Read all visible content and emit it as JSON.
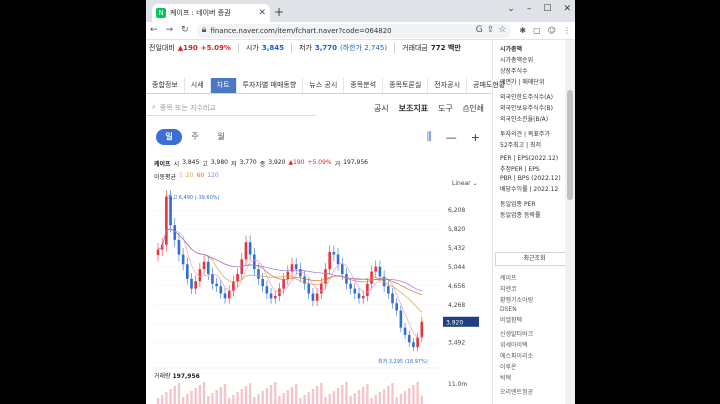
{
  "browser": {
    "tab_title": "케이프 : 네이버 증권",
    "url": "finance.naver.com/item/fchart.naver?code=064820"
  },
  "quote": {
    "prev_label": "전일대비",
    "change": "▲190",
    "pct": "+5.09%",
    "high_label": "시가",
    "open": "3,845",
    "low_label": "저가",
    "low": "3,770",
    "low_limit": "(하한가 2,745)",
    "amount_label": "거래대금",
    "amount": "772 백만"
  },
  "nav": {
    "tabs": [
      "종합정보",
      "시세",
      "차트",
      "투자자별 매매동향",
      "뉴스 공시",
      "종목분석",
      "종목토론실",
      "전자공시",
      "공매도현황"
    ],
    "active": "차트"
  },
  "search": {
    "placeholder": "종목 또는 지수비교"
  },
  "tools": {
    "notice": "공시",
    "indicator": "보조지표",
    "tool": "도구",
    "print": "인쇄"
  },
  "periods": {
    "day": "일",
    "week": "주",
    "month": "월"
  },
  "ohlc": {
    "name": "케이프",
    "open_label": "시",
    "open": "3,845",
    "high_label": "고",
    "high": "3,980",
    "low_label": "저",
    "low": "3,770",
    "close_label": "종",
    "close": "3,920",
    "change": "▲190",
    "pct": "+5.09%",
    "vol_label": "거",
    "vol": "197,956"
  },
  "ma": {
    "label": "이동평균",
    "p5": "5",
    "p20": "20",
    "p60": "60",
    "p120": "120"
  },
  "scale": "Linear",
  "chart_data": {
    "type": "candlestick",
    "y_ticks": [
      "6,208",
      "5,820",
      "5,432",
      "5,044",
      "4,656",
      "4,268",
      "3,880",
      "3,492"
    ],
    "current_price": "3,920",
    "max_annot": "최고 6,490 (-39.60%)",
    "min_annot": "최저 3,295 (18.97%)",
    "closes": [
      5400,
      5500,
      6490,
      5900,
      5600,
      5300,
      5100,
      4800,
      4600,
      4750,
      5000,
      5150,
      4900,
      4700,
      4650,
      4500,
      4400,
      4550,
      4750,
      4900,
      5200,
      5550,
      5300,
      5000,
      4800,
      4650,
      4500,
      4400,
      4450,
      4600,
      4800,
      4950,
      5100,
      5000,
      4850,
      4700,
      4500,
      4350,
      4500,
      4700,
      5000,
      5350,
      5300,
      5100,
      4900,
      4700,
      4600,
      4500,
      4400,
      4450,
      4700,
      4950,
      5050,
      4850,
      4650,
      4500,
      4300,
      4150,
      3800,
      3650,
      3500,
      3400,
      3600,
      3920
    ],
    "volume_label": "거래량",
    "volume": "197,956",
    "vol_axis": "11.0m"
  },
  "right_panel": {
    "items": [
      "시가총액",
      "시가총액순위",
      "상장주식수",
      "액면가 | 매매단위",
      "",
      "외국인한도주식수(A)",
      "외국인보유주식수(B)",
      "외국인소진율(B/A)",
      "",
      "투자의견 | 목표주가",
      "52주최고 | 최저",
      "",
      "PER | EPS(2022.12)",
      "추정PER | EPS",
      "PBR | BPS (2022.12)",
      "배당수익률 | 2022.12",
      "",
      "동일업종 PER",
      "동일업종 등락률"
    ],
    "recent_title": "최근조회",
    "recent": [
      "케이프",
      "지엔코",
      "황쟁기소아링",
      "DSEN",
      "비엘팜텍",
      "",
      "신생알티바크",
      "위세아이텍",
      "에스피이리소",
      "이루온",
      "빅텍",
      "",
      "오리엔트정공"
    ]
  }
}
